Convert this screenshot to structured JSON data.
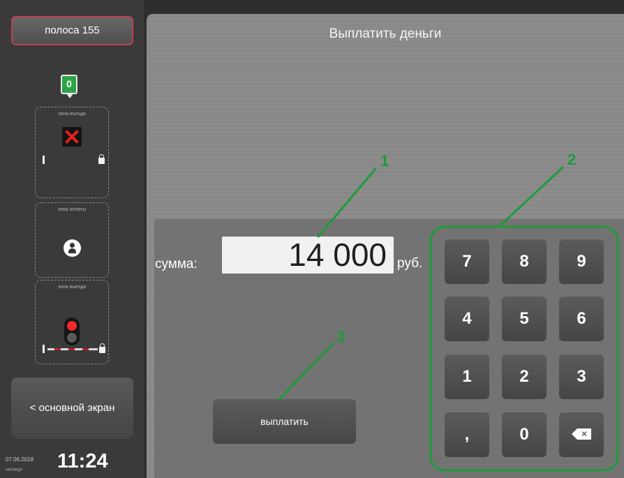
{
  "sidebar": {
    "lane_label": "полоса 155",
    "counter": "0",
    "zones": {
      "entry_label": "зона въезда",
      "payment_label": "зона оплаты",
      "exit_label": "зона выезда"
    },
    "main_screen_label": "< основной экран",
    "date": "07.06.2018",
    "weekday": "четверг",
    "time": "11:24"
  },
  "panel": {
    "title": "Выплатить деньги",
    "amount_label": "сумма:",
    "amount_value": "14 000",
    "currency": "руб.",
    "pay_button_label": "выплатить"
  },
  "keypad": {
    "keys": [
      "7",
      "8",
      "9",
      "4",
      "5",
      "6",
      "1",
      "2",
      "3",
      ",",
      "0"
    ],
    "backspace_icon": "backspace-icon"
  },
  "annotations": {
    "labels": [
      "1",
      "2",
      "3"
    ],
    "color": "#1d9b3a"
  },
  "colors": {
    "lane_border": "#c2404f",
    "counter_badge": "#2da447",
    "signal_red": "#e52020"
  }
}
